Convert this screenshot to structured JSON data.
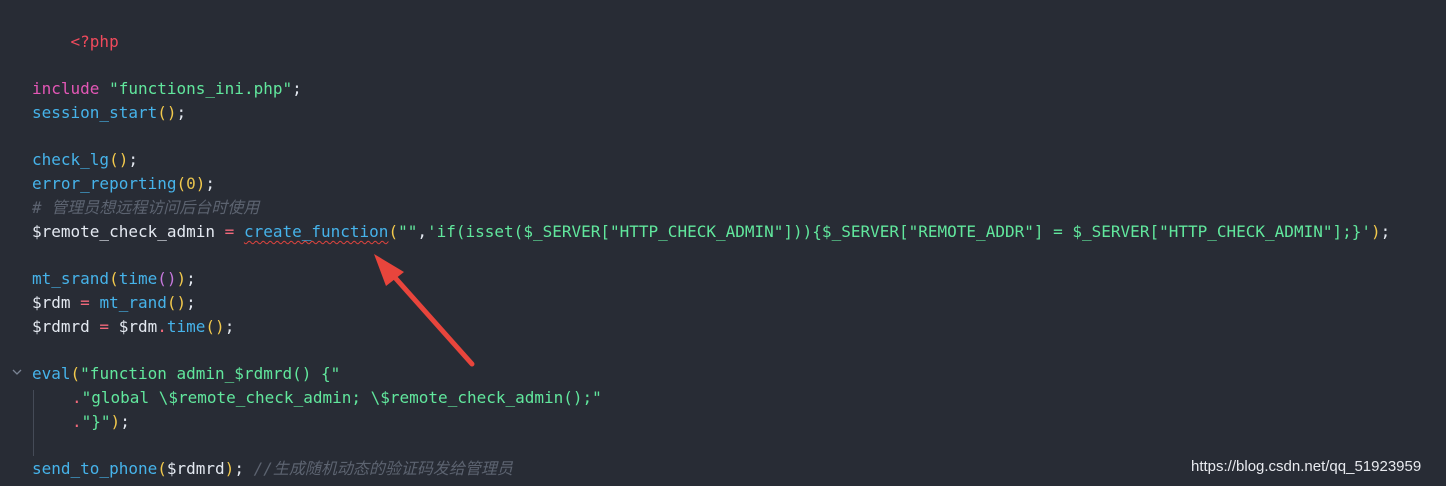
{
  "editor": {
    "theme_colors": {
      "background": "#282c35",
      "keyword": "#e357b6",
      "function": "#46b3ea",
      "string": "#61e79d",
      "variable": "#e4e9f1",
      "comment": "#5c6370",
      "tag": "#f04a5c"
    },
    "lines": {
      "l1": {
        "t1": "<?php"
      },
      "l2": {
        "t1": "include",
        "t2": " ",
        "t3": "\"functions_ini.php\"",
        "t4": ";"
      },
      "l3": {
        "t1": "session_start",
        "t2": "(",
        "t3": ")",
        "t4": ";"
      },
      "l4": {
        "t1": "check_lg",
        "t2": "(",
        "t3": ")",
        "t4": ";"
      },
      "l5": {
        "t1": "error_reporting",
        "t2": "(",
        "t3": "0",
        "t4": ")",
        "t5": ";"
      },
      "l6": {
        "t1": "# 管理员想远程访问后台时使用"
      },
      "l7": {
        "t1": "$remote_check_admin",
        "t2": " = ",
        "t3": "create_function",
        "t4": "(",
        "t5": "\"\"",
        "t6": ",",
        "t7": "'if(isset($_SERVER[\"HTTP_CHECK_ADMIN\"])){$_SERVER[\"REMOTE_ADDR\"] = $_SERVER[\"HTTP_CHECK_ADMIN\"];}'",
        "t8": ")",
        "t9": ";"
      },
      "l8": {
        "t1": "mt_srand",
        "t2": "(",
        "t3": "time",
        "t4": "(",
        "t5": ")",
        "t6": ")",
        "t7": ";"
      },
      "l9": {
        "t1": "$rdm",
        "t2": " = ",
        "t3": "mt_rand",
        "t4": "(",
        "t5": ")",
        "t6": ";"
      },
      "l10": {
        "t1": "$rdmrd",
        "t2": " = ",
        "t3": "$rdm",
        "t4": ".",
        "t5": "time",
        "t6": "(",
        "t7": ")",
        "t8": ";"
      },
      "l11": {
        "t1": "eval",
        "t2": "(",
        "t3": "\"function admin_$rdmrd() {\""
      },
      "l12": {
        "t1": ".",
        "t2": "\"global \\$remote_check_admin; \\$remote_check_admin();\""
      },
      "l13": {
        "t1": ".",
        "t2": "\"}\"",
        "t3": ")",
        "t4": ";"
      },
      "l14": {
        "t1": "send_to_phone",
        "t2": "(",
        "t3": "$rdmrd",
        "t4": ")",
        "t5": ";",
        "t6": " ",
        "t7": "//生成随机动态的验证码发给管理员"
      }
    },
    "fold_icon": "chevron-down-icon"
  },
  "annotation": {
    "arrow_color": "#e8453c"
  },
  "watermark": "https://blog.csdn.net/qq_51923959"
}
